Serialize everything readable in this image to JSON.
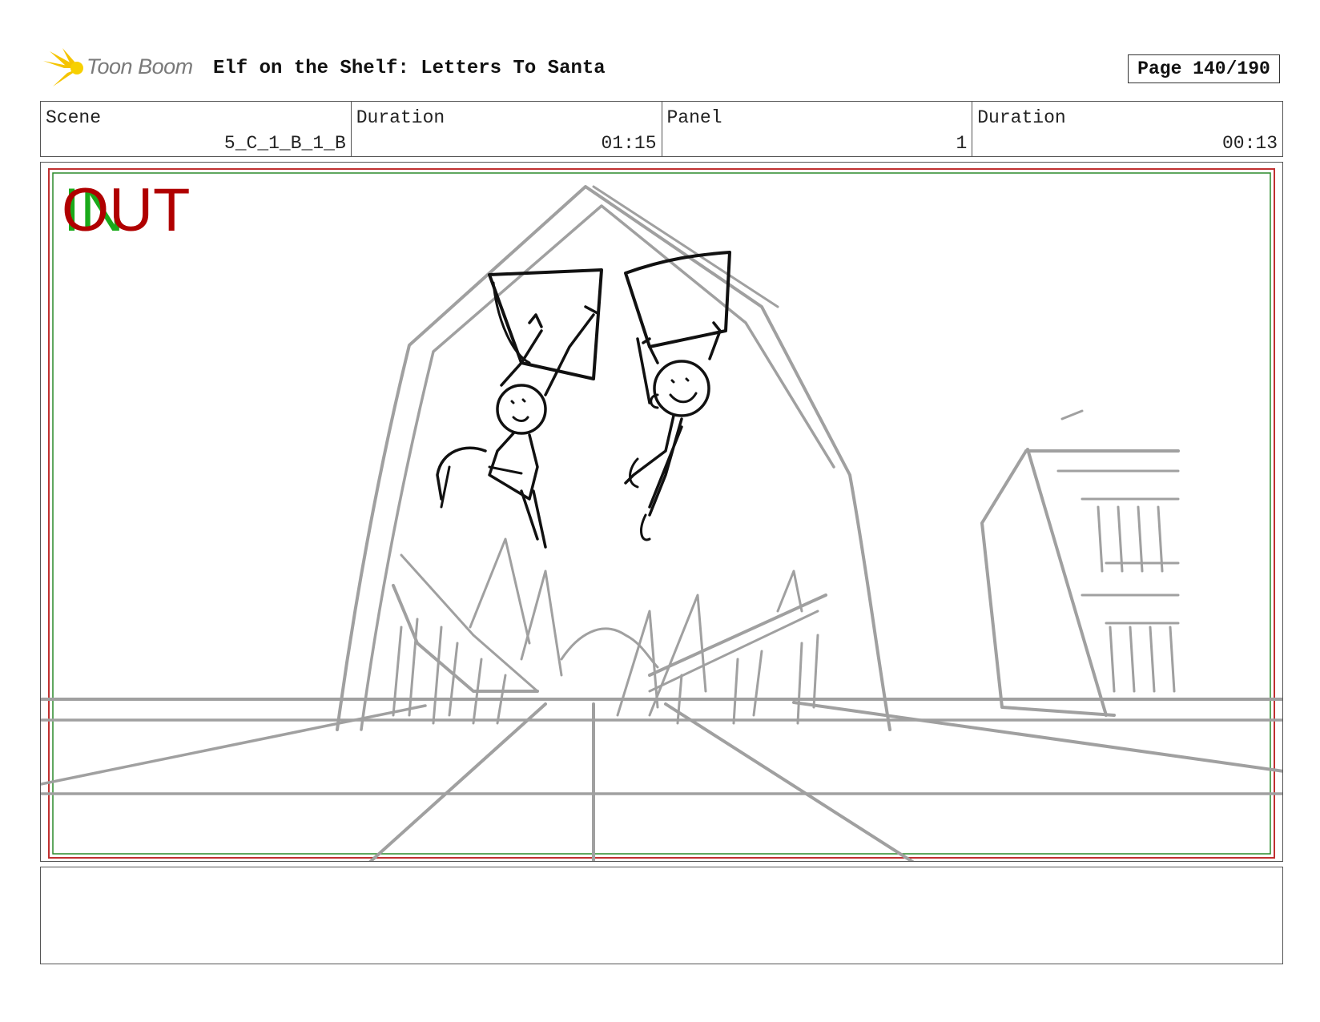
{
  "header": {
    "logo_text": "Toon Boom",
    "project_title": "Elf on the Shelf: Letters To Santa",
    "page": "Page 140/190"
  },
  "info": [
    {
      "label": "Scene",
      "value": "5_C_1_B_1_B"
    },
    {
      "label": "Duration",
      "value": "01:15"
    },
    {
      "label": "Panel",
      "value": "1"
    },
    {
      "label": "Duration",
      "value": "00:13"
    }
  ],
  "panel": {
    "in_marker": "IN",
    "out_marker": "OUT",
    "colors": {
      "in": "#1aaa1a",
      "out": "#b00000",
      "sketch_gray": "#a0a0a0",
      "sketch_ink": "#111111"
    }
  },
  "notes": {
    "text": ""
  }
}
